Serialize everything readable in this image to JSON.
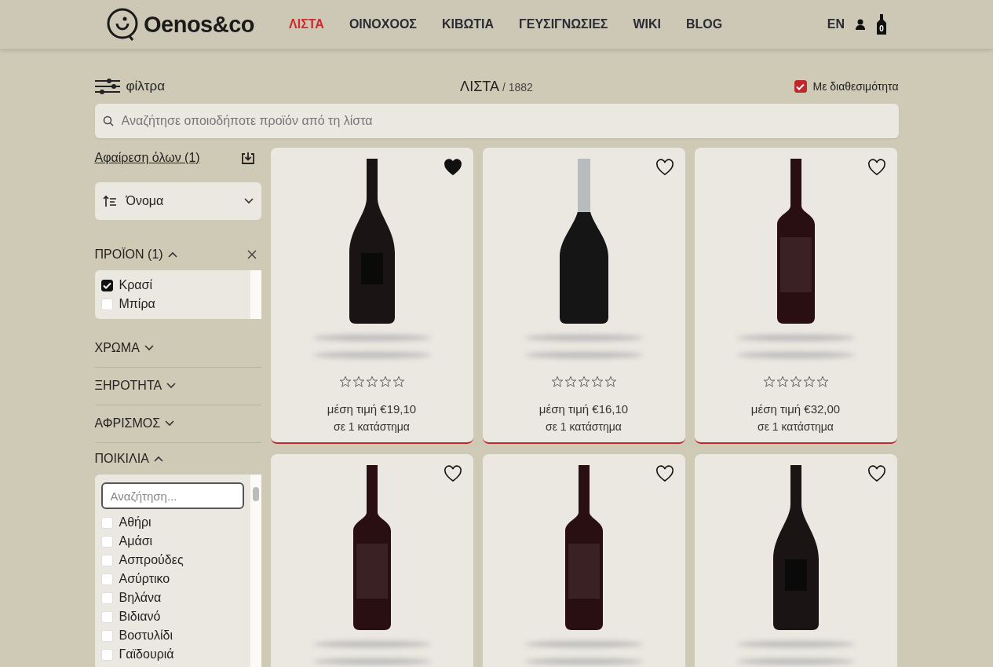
{
  "header": {
    "logo": "Oenos&co",
    "nav": [
      {
        "label": "ΛΙΣΤΑ",
        "selected": true
      },
      {
        "label": "ΟΙΝΟΧΟΟΣ",
        "selected": false
      },
      {
        "label": "ΚΙΒΩΤΙΑ",
        "selected": false
      },
      {
        "label": "ΓΕΥΣΙΓΝΩΣΙΕΣ",
        "selected": false
      },
      {
        "label": "WIKI",
        "selected": false
      },
      {
        "label": "BLOG",
        "selected": false
      }
    ],
    "language": "EN",
    "cart_count": "0"
  },
  "toolbar": {
    "filters_label": "φίλτρα",
    "title": "ΛΙΣΤΑ",
    "count": "/ 1882",
    "availability": {
      "label": "Με διαθεσιμότητα",
      "checked": true
    }
  },
  "search": {
    "placeholder": "Αναζήτησε οποιοδήποτε προϊόν από τη λίστα"
  },
  "sidebar": {
    "clear_all": "Αφαίρεση όλων (1)",
    "sort": {
      "value": "Όνομα"
    },
    "groups": [
      {
        "title": "ΠΡΟΪΟΝ (1)",
        "expanded": true,
        "clearable": true,
        "options": [
          {
            "label": "Κρασί",
            "checked": true
          },
          {
            "label": "Μπίρα",
            "checked": false
          }
        ]
      },
      {
        "title": "ΧΡΩΜΑ",
        "expanded": false
      },
      {
        "title": "ΞΗΡΟΤΗΤΑ",
        "expanded": false
      },
      {
        "title": "ΑΦΡΙΣΜΟΣ",
        "expanded": false
      },
      {
        "title": "ΠΟΙΚΙΛΙΑ",
        "expanded": true,
        "search_placeholder": "Αναζήτηση...",
        "options": [
          {
            "label": "Αθήρι",
            "checked": false
          },
          {
            "label": "Αμάσι",
            "checked": false
          },
          {
            "label": "Ασπρούδες",
            "checked": false
          },
          {
            "label": "Ασύρτικο",
            "checked": false
          },
          {
            "label": "Βηλάνα",
            "checked": false
          },
          {
            "label": "Βιδιανό",
            "checked": false
          },
          {
            "label": "Βοστυλίδι",
            "checked": false
          },
          {
            "label": "Γαϊδουριά",
            "checked": false
          }
        ]
      }
    ]
  },
  "products": [
    {
      "kind": "burgundy",
      "favorite": true,
      "stars": 0,
      "price": "μέση τιμή €19,10",
      "stores": "σε 1 κατάστημα"
    },
    {
      "kind": "sparkling",
      "favorite": false,
      "stars": 0,
      "price": "μέση τιμή €16,10",
      "stores": "σε 1 κατάστημα"
    },
    {
      "kind": "bordeaux",
      "favorite": false,
      "stars": 0,
      "price": "μέση τιμή €32,00",
      "stores": "σε 1 κατάστημα"
    },
    {
      "kind": "bordeaux",
      "favorite": false
    },
    {
      "kind": "bordeaux",
      "favorite": false
    },
    {
      "kind": "burgundy",
      "favorite": false
    }
  ]
}
